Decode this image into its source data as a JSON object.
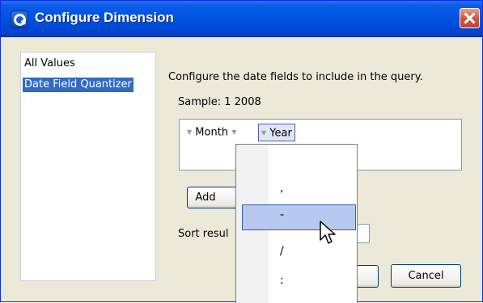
{
  "window": {
    "title": "Configure Dimension"
  },
  "sidebar": {
    "items": [
      {
        "label": "All Values"
      },
      {
        "label": "Date Field Quantizer"
      }
    ]
  },
  "main": {
    "description": "Configure the date fields to include in the query.",
    "sample": "Sample: 1 2008",
    "fields": [
      {
        "label": "Month"
      },
      {
        "label": "Year"
      }
    ],
    "add_label": "Add",
    "sort_label": "Sort resul",
    "cancel_label": "Cancel"
  },
  "separator_menu": {
    "items": [
      {
        "label": ","
      },
      {
        "label": "-"
      },
      {
        "label": "/"
      },
      {
        "label": ":"
      }
    ],
    "highlighted_index": 1
  },
  "colors": {
    "title_bar": "#0054e3",
    "selection": "#3169c6",
    "menu_highlight": "#b7c9ee"
  }
}
